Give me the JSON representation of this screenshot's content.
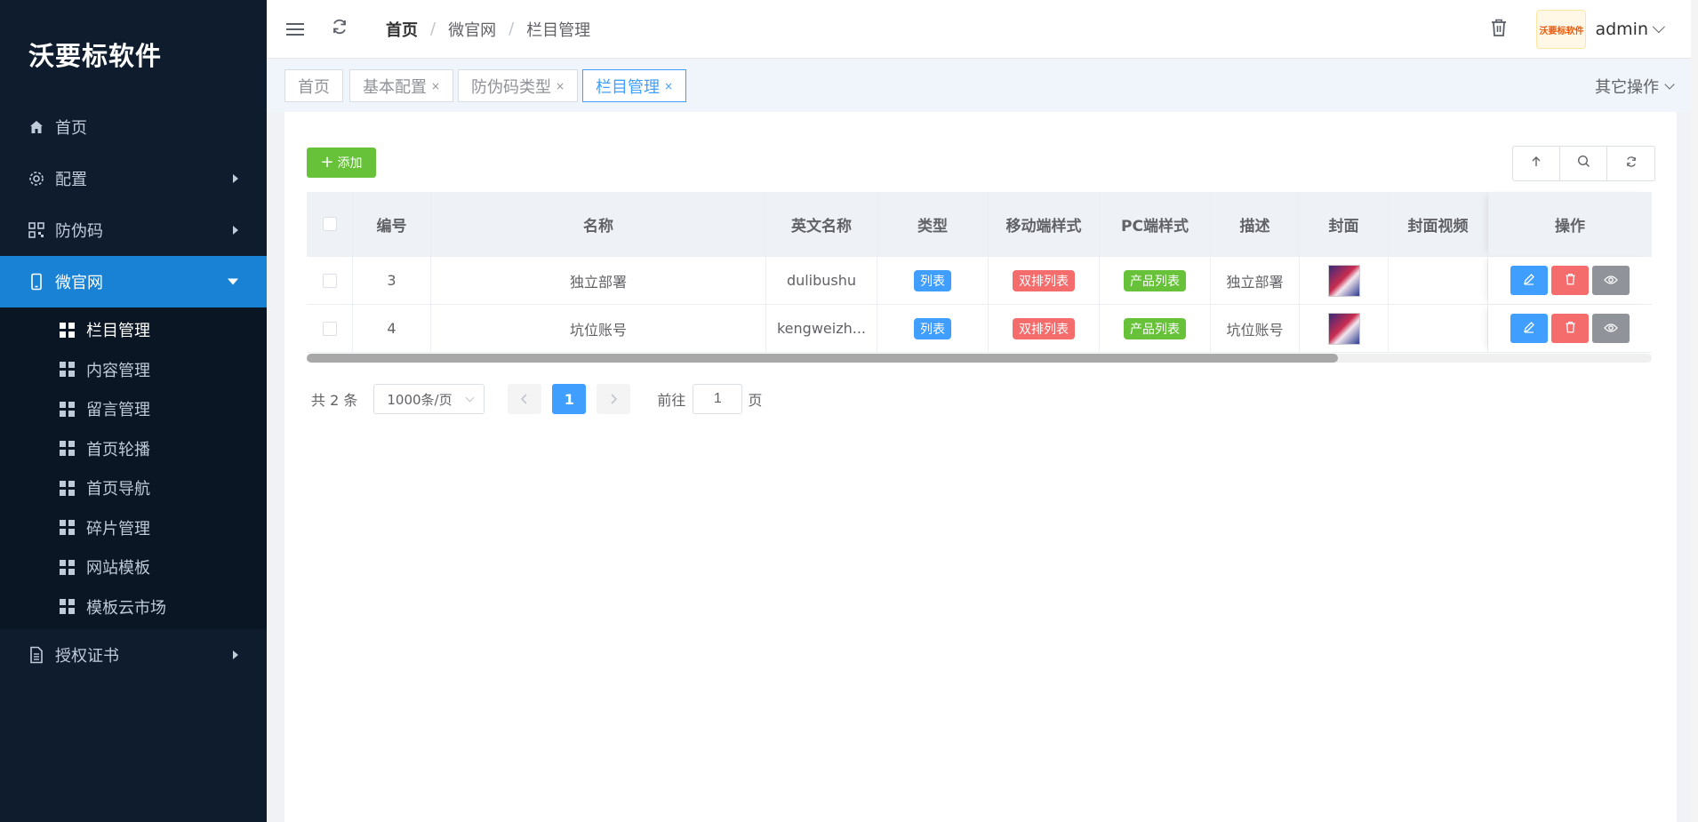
{
  "sidebar": {
    "logo": "沃要标软件",
    "menu": [
      {
        "label": "首页",
        "icon": "home-icon"
      },
      {
        "label": "配置",
        "icon": "gear-icon"
      },
      {
        "label": "防伪码",
        "icon": "qrcode-icon"
      },
      {
        "label": "微官网",
        "icon": "mobile-icon"
      },
      {
        "label": "授权证书",
        "icon": "document-icon"
      }
    ],
    "submenu": [
      "栏目管理",
      "内容管理",
      "留言管理",
      "首页轮播",
      "首页导航",
      "碎片管理",
      "网站模板",
      "模板云市场"
    ]
  },
  "header": {
    "breadcrumb": [
      "首页",
      "微官网",
      "栏目管理"
    ],
    "user": "admin",
    "avatar_text": "沃要标软件"
  },
  "tags": {
    "items": [
      "首页",
      "基本配置",
      "防伪码类型",
      "栏目管理"
    ],
    "close": "×",
    "other_ops": "其它操作"
  },
  "toolbar": {
    "add_label": "添加"
  },
  "table": {
    "columns": [
      "编号",
      "名称",
      "英文名称",
      "类型",
      "移动端样式",
      "PC端样式",
      "描述",
      "封面",
      "封面视频",
      "操作"
    ],
    "rows": [
      {
        "id": "3",
        "name": "独立部署",
        "en": "dulibushu",
        "type": "列表",
        "mobile": "双排列表",
        "pc": "产品列表",
        "desc": "独立部署"
      },
      {
        "id": "4",
        "name": "坑位账号",
        "en": "kengweizh...",
        "type": "列表",
        "mobile": "双排列表",
        "pc": "产品列表",
        "desc": "坑位账号"
      }
    ]
  },
  "pager": {
    "total": "共 2 条",
    "page_size": "1000条/页",
    "current": "1",
    "goto_label": "前往",
    "goto_value": "1",
    "page_suffix": "页"
  },
  "colors": {
    "sidebar_bg": "#0f1c2e",
    "active_menu": "#1a82d4",
    "primary": "#409eff",
    "success": "#67c23a",
    "danger": "#f56c6c",
    "info": "#909399"
  }
}
